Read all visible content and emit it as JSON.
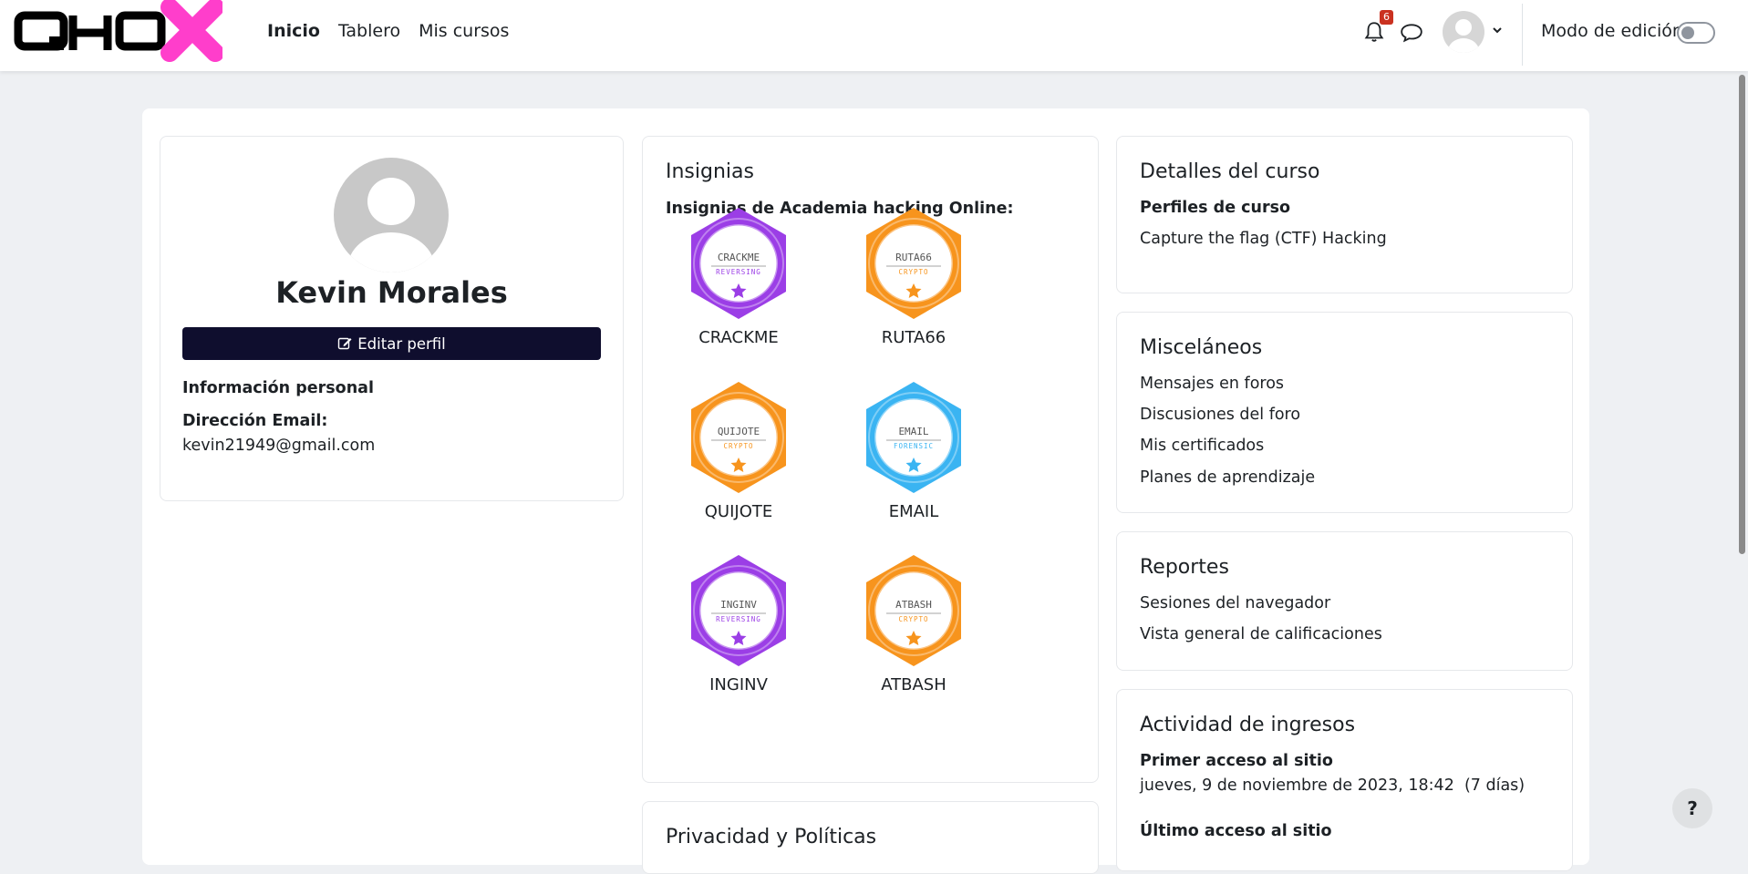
{
  "navbar": {
    "links": [
      "Inicio",
      "Tablero",
      "Mis cursos"
    ],
    "notification_count": "6",
    "edit_mode_label": "Modo de edición",
    "edit_mode_on": false
  },
  "profile": {
    "name": "Kevin Morales",
    "edit_button": "Editar perfil",
    "section_title": "Información personal",
    "email_label": "Dirección Email:",
    "email": "kevin21949@gmail.com"
  },
  "badges": {
    "title": "Insignias",
    "subtitle": "Insignias de Academia hacking Online:",
    "items": [
      {
        "label": "CRACKME",
        "top_text": "CRACKME",
        "sub_text": "REVERSING",
        "color": "#9b3ee6"
      },
      {
        "label": "RUTA66",
        "top_text": "RUTA66",
        "sub_text": "CRYPTO",
        "color": "#f7941d"
      },
      {
        "label": "QUIJOTE",
        "top_text": "QUIJOTE",
        "sub_text": "CRYPTO",
        "color": "#f7941d"
      },
      {
        "label": "EMAIL",
        "top_text": "EMAIL",
        "sub_text": "FORENSIC",
        "color": "#3ab4f2"
      },
      {
        "label": "INGINV",
        "top_text": "INGINV",
        "sub_text": "REVERSING",
        "color": "#9b3ee6"
      },
      {
        "label": "ATBASH",
        "top_text": "ATBASH",
        "sub_text": "CRYPTO",
        "color": "#f7941d"
      }
    ],
    "next_section_title": "Privacidad y Políticas"
  },
  "course_details": {
    "title": "Detalles del curso",
    "subtitle": "Perfiles de curso",
    "items": [
      "Capture the flag (CTF) Hacking"
    ]
  },
  "misc": {
    "title": "Misceláneos",
    "items": [
      "Mensajes en foros",
      "Discusiones del foro",
      "Mis certificados",
      "Planes de aprendizaje"
    ]
  },
  "reports": {
    "title": "Reportes",
    "items": [
      "Sesiones del navegador",
      "Vista general de calificaciones"
    ]
  },
  "activity": {
    "title": "Actividad de ingresos",
    "first_access_label": "Primer acceso al sitio",
    "first_access_value": "jueves, 9 de noviembre de 2023, 18:42  (7 días)",
    "last_access_label": "Último acceso al sitio"
  },
  "help": {
    "label": "?"
  },
  "colors": {
    "logo_pink": "#ff3ecb",
    "button_dark": "#0f0e2e"
  }
}
